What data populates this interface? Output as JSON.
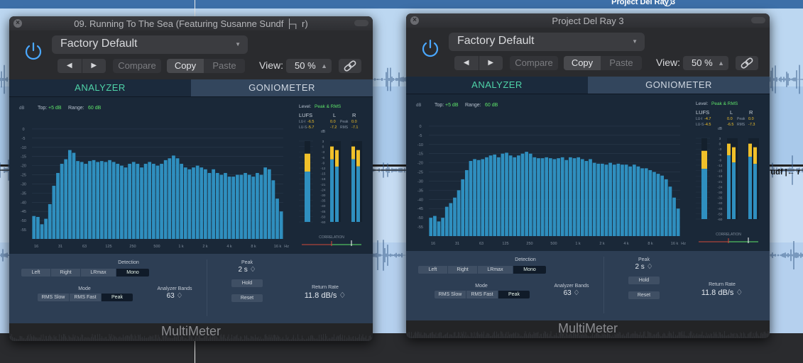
{
  "background": {
    "project_label": "Project Del Ray 3",
    "side_label": "udf",
    "side_label_suffix": "|← r"
  },
  "plugins": [
    {
      "window_title": "09. Running To The Sea (Featuring Susanne Sundf ├┐ r)",
      "preset": "Factory Default",
      "nav_prev": "◀",
      "nav_next": "▶",
      "compare": "Compare",
      "copy": "Copy",
      "paste": "Paste",
      "view_label": "View:",
      "view_value": "50 %",
      "tabs": [
        "ANALYZER",
        "GONIOMETER"
      ],
      "analyzer": {
        "top_label": "Top:",
        "top_value": "+5 dB",
        "range_label": "Range:",
        "range_value": "60 dB",
        "db_unit": "dB",
        "y_ticks": [
          "0",
          "-5",
          "-10",
          "-15",
          "-20",
          "-25",
          "-30",
          "-35",
          "-40",
          "-45",
          "-50",
          "-55"
        ],
        "x_ticks": [
          "16",
          "31",
          "63",
          "125",
          "250",
          "500",
          "1 k",
          "2 k",
          "4 k",
          "8 k",
          "16 k"
        ],
        "x_unit": "Hz",
        "bands": [
          -47.5,
          -48,
          -52,
          -49,
          -41,
          -31,
          -24,
          -19,
          -16.5,
          -11.5,
          -13,
          -17.5,
          -18,
          -19,
          -17.5,
          -17,
          -18,
          -17.5,
          -18,
          -17,
          -18,
          -19,
          -20,
          -21,
          -19,
          -18,
          -19,
          -21,
          -19,
          -18,
          -19,
          -20,
          -19,
          -17,
          -16,
          -14.5,
          -16,
          -19,
          -21,
          -22,
          -21,
          -20,
          -21,
          -22,
          -24,
          -22,
          -24,
          -25,
          -24,
          -26,
          -26,
          -25,
          -25,
          -24,
          -25,
          -26,
          -24,
          -25,
          -21,
          -22,
          -28,
          -38,
          -45
        ]
      },
      "level": {
        "level_label": "Level:",
        "level_value": "Peak & RMS",
        "lufs_label": "LUFS",
        "lu_i_label": "LU-I",
        "lu_i_value": "-6.5",
        "lu_s_label": "LU-S",
        "lu_s_value": "-5.7",
        "l_label": "L",
        "r_label": "R",
        "peak_label": "Peak",
        "rms_label": "RMS",
        "l_peak": "0.0",
        "r_peak": "0.0",
        "l_rms": "-7.2",
        "r_rms": "-7.1",
        "db_unit": "dB",
        "scale": [
          "3",
          "0",
          "-3",
          "-6",
          "-9",
          "-12",
          "-15",
          "-18",
          "-21",
          "-24",
          "-30",
          "-35",
          "-40",
          "-45",
          "-50",
          "-60"
        ],
        "correlation_label": "CORRELATION"
      },
      "controls": {
        "detection_label": "Detection",
        "detection_options": [
          "Left",
          "Right",
          "LRmax",
          "Mono"
        ],
        "detection_selected": "Mono",
        "mode_label": "Mode",
        "mode_options": [
          "RMS Slow",
          "RMS Fast",
          "Peak"
        ],
        "mode_selected": "Peak",
        "bands_label": "Analyzer Bands",
        "bands_value": "63 ♢",
        "peak_label": "Peak",
        "peak_value": "2 s ♢",
        "hold_label": "Hold",
        "reset_label": "Reset",
        "return_label": "Return Rate",
        "return_value": "11.8 dB/s ♢"
      },
      "plugin_name": "MultiMeter"
    },
    {
      "window_title": "Project Del Ray 3",
      "preset": "Factory Default",
      "nav_prev": "◀",
      "nav_next": "▶",
      "compare": "Compare",
      "copy": "Copy",
      "paste": "Paste",
      "view_label": "View:",
      "view_value": "50 %",
      "tabs": [
        "ANALYZER",
        "GONIOMETER"
      ],
      "analyzer": {
        "top_label": "Top:",
        "top_value": "+5 dB",
        "range_label": "Range:",
        "range_value": "60 dB",
        "db_unit": "dB",
        "y_ticks": [
          "0",
          "-5",
          "-10",
          "-15",
          "-20",
          "-25",
          "-30",
          "-35",
          "-40",
          "-45",
          "-50",
          "-55"
        ],
        "x_ticks": [
          "16",
          "31",
          "63",
          "125",
          "250",
          "500",
          "1 k",
          "2 k",
          "4 k",
          "8 k",
          "16 k"
        ],
        "x_unit": "Hz",
        "bands": [
          -50,
          -49,
          -52,
          -50,
          -44,
          -42,
          -39,
          -35,
          -29,
          -24,
          -19,
          -18,
          -18.5,
          -18,
          -17,
          -16,
          -15.5,
          -17,
          -15,
          -14.5,
          -16,
          -17,
          -16,
          -15,
          -14,
          -15,
          -17,
          -17.5,
          -17.5,
          -17,
          -17.5,
          -18,
          -17.5,
          -17,
          -18.5,
          -17,
          -17.5,
          -17,
          -18,
          -19,
          -18,
          -20,
          -20.5,
          -20.5,
          -21,
          -20,
          -21,
          -20.5,
          -21,
          -21,
          -22,
          -21,
          -22,
          -23,
          -23,
          -24,
          -25,
          -26,
          -27,
          -29,
          -33,
          -39,
          -45
        ]
      },
      "level": {
        "level_label": "Level:",
        "level_value": "Peak & RMS",
        "lufs_label": "LUFS",
        "lu_i_label": "LU-I",
        "lu_i_value": "-4.7",
        "lu_s_label": "LU-S",
        "lu_s_value": "-4.5",
        "l_label": "L",
        "r_label": "R",
        "peak_label": "Peak",
        "rms_label": "RMS",
        "l_peak": "0.0",
        "r_peak": "0.0",
        "l_rms": "-6.5",
        "r_rms": "-7.3",
        "db_unit": "dB",
        "scale": [
          "3",
          "0",
          "-3",
          "-6",
          "-9",
          "-12",
          "-15",
          "-18",
          "-21",
          "-24",
          "-30",
          "-35",
          "-40",
          "-45",
          "-50",
          "-60"
        ],
        "correlation_label": "CORRELATION"
      },
      "controls": {
        "detection_label": "Detection",
        "detection_options": [
          "Left",
          "Right",
          "LRmax",
          "Mono"
        ],
        "detection_selected": "Mono",
        "mode_label": "Mode",
        "mode_options": [
          "RMS Slow",
          "RMS Fast",
          "Peak"
        ],
        "mode_selected": "Peak",
        "bands_label": "Analyzer Bands",
        "bands_value": "63 ♢",
        "peak_label": "Peak",
        "peak_value": "2 s ♢",
        "hold_label": "Hold",
        "reset_label": "Reset",
        "return_label": "Return Rate",
        "return_value": "11.8 dB/s ♢"
      },
      "plugin_name": "MultiMeter"
    }
  ],
  "meters": [
    {
      "lufs_top": -4,
      "lufs_rms": -14,
      "l_peak_db": 0,
      "l_rms_db": -7.2,
      "r_peak_db": 0,
      "r_rms_db": -7.1
    },
    {
      "lufs_top": -4,
      "lufs_rms": -14,
      "l_peak_db": 0,
      "l_rms_db": -6.5,
      "r_peak_db": 0,
      "r_rms_db": -7.3
    }
  ],
  "colors": {
    "bar": "#2f8fbf",
    "tab_active_text": "#4fd4a9",
    "accent_green": "#5ee56a",
    "value_yellow": "#f0c02a",
    "power_blue": "#4aa8ff"
  }
}
